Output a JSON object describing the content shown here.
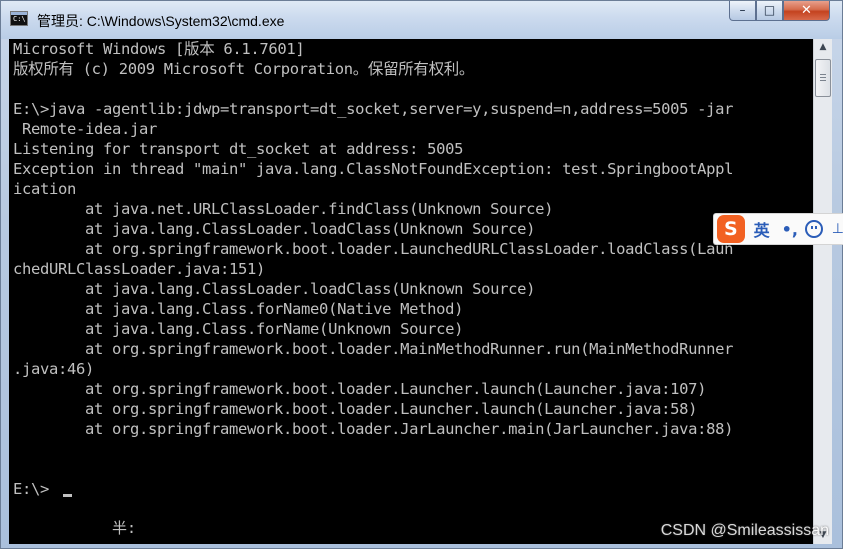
{
  "window": {
    "title": "管理员: C:\\Windows\\System32\\cmd.exe",
    "icon": "cmd-icon",
    "buttons": {
      "minimize": "–",
      "maximize": "□",
      "close": "✕"
    }
  },
  "console": {
    "lines": [
      "Microsoft Windows [版本 6.1.7601]",
      "版权所有 (c) 2009 Microsoft Corporation。保留所有权利。",
      "",
      "E:\\>java -agentlib:jdwp=transport=dt_socket,server=y,suspend=n,address=5005 -jar",
      " Remote-idea.jar",
      "Listening for transport dt_socket at address: 5005",
      "Exception in thread \"main\" java.lang.ClassNotFoundException: test.SpringbootAppl",
      "ication",
      "        at java.net.URLClassLoader.findClass(Unknown Source)",
      "        at java.lang.ClassLoader.loadClass(Unknown Source)",
      "        at org.springframework.boot.loader.LaunchedURLClassLoader.loadClass(Laun",
      "chedURLClassLoader.java:151)",
      "        at java.lang.ClassLoader.loadClass(Unknown Source)",
      "        at java.lang.Class.forName0(Native Method)",
      "        at java.lang.Class.forName(Unknown Source)",
      "        at org.springframework.boot.loader.MainMethodRunner.run(MainMethodRunner",
      ".java:46)",
      "        at org.springframework.boot.loader.Launcher.launch(Launcher.java:107)",
      "        at org.springframework.boot.loader.Launcher.launch(Launcher.java:58)",
      "        at org.springframework.boot.loader.JarLauncher.main(JarLauncher.java:88)",
      "",
      "",
      "E:\\>"
    ],
    "ime_status": "半:",
    "colors": {
      "background": "#000000",
      "text": "#c0c0c0"
    }
  },
  "ime_toolbar": {
    "logo": "S",
    "language": "英",
    "punctuation": "•,",
    "emoji_icon": "smiley-icon",
    "more": "⊥"
  },
  "watermark": "CSDN @Smileassissan"
}
